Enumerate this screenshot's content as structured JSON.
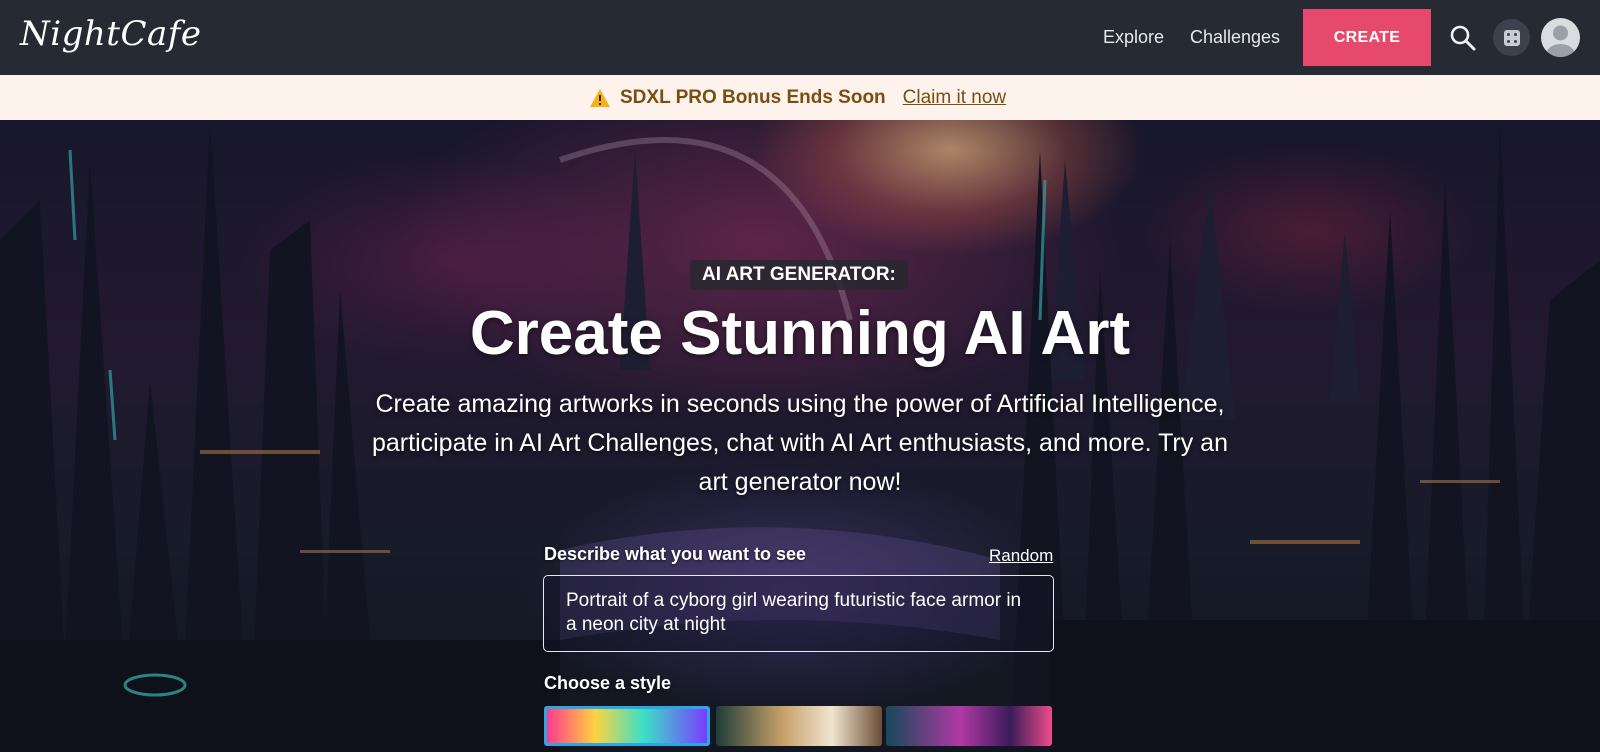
{
  "nav": {
    "logo": "NightCafe",
    "links": [
      "Explore",
      "Challenges"
    ],
    "create_label": "CREATE",
    "icons": [
      "search-icon",
      "dice-icon",
      "avatar-icon"
    ]
  },
  "banner": {
    "icon": "warning-icon",
    "text": "SDXL PRO Bonus Ends Soon",
    "link": "Claim it now",
    "color": "#7a4e12"
  },
  "hero": {
    "tag": "AI ART GENERATOR:",
    "title": "Create Stunning AI Art",
    "subtitle": "Create amazing artworks in seconds using the power of Artificial Intelligence, participate in AI Art Challenges, chat with AI Art enthusiasts, and more. Try an art generator now!"
  },
  "prompt": {
    "label": "Describe what you want to see",
    "random_label": "Random",
    "value": "Portrait of a cyborg girl wearing futuristic face armor in a neon city at night"
  },
  "styles": {
    "label": "Choose a style",
    "selected_index": 0
  },
  "colors": {
    "nav_bg": "#252a33",
    "accent": "#e6496b",
    "banner_bg": "#fdf3ec",
    "selected_border": "#2ba7e6"
  }
}
